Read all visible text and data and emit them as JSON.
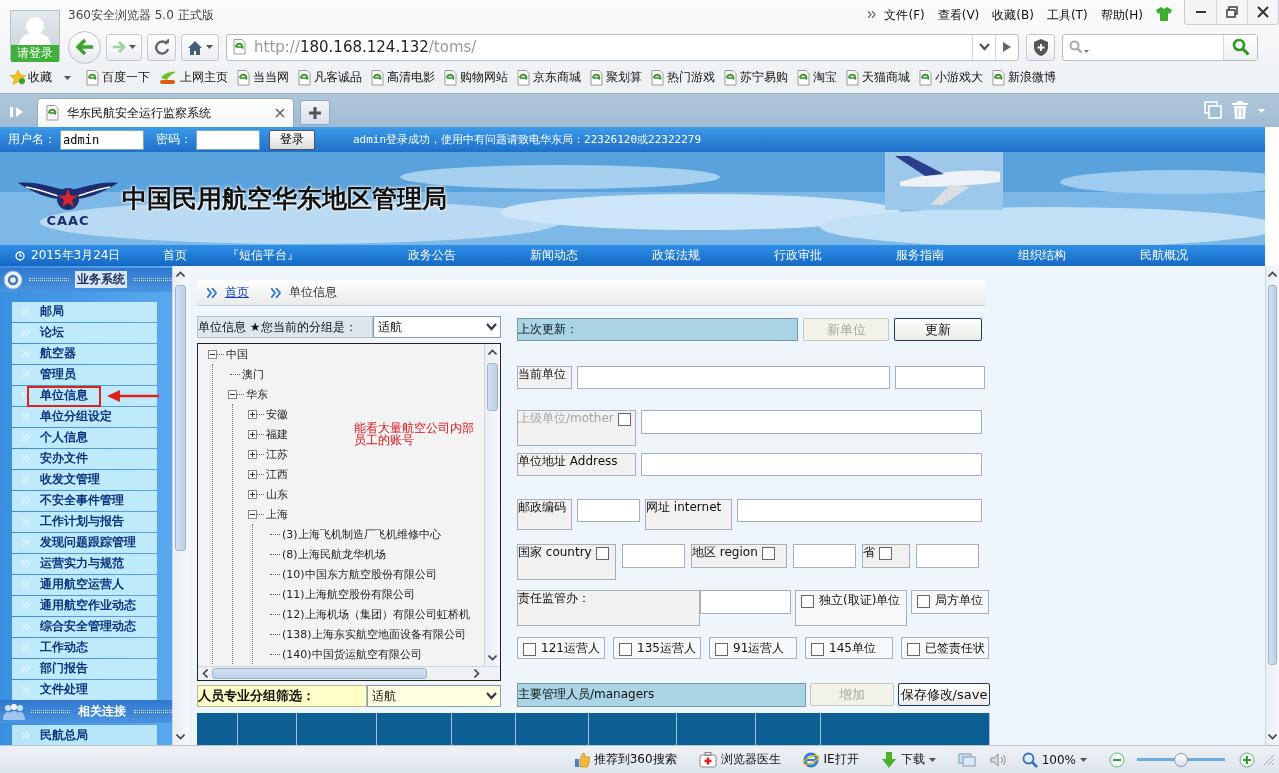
{
  "browser": {
    "title": "360安全浏览器 5.0 正式版",
    "avatar_label": "请登录",
    "menu": [
      "文件(F)",
      "查看(V)",
      "收藏(B)",
      "工具(T)",
      "帮助(H)"
    ],
    "address": {
      "scheme": "http://",
      "host": "180.168.124.132",
      "path": "/toms/"
    },
    "favorites_label": "收藏",
    "bookmarks": [
      {
        "label": "百度一下",
        "kind": "page"
      },
      {
        "label": "上网主页",
        "kind": "hao"
      },
      {
        "label": "当当网",
        "kind": "page"
      },
      {
        "label": "凡客诚品",
        "kind": "page"
      },
      {
        "label": "高清电影",
        "kind": "page"
      },
      {
        "label": "购物网站",
        "kind": "page"
      },
      {
        "label": "京东商城",
        "kind": "page"
      },
      {
        "label": "聚划算",
        "kind": "page"
      },
      {
        "label": "热门游戏",
        "kind": "page"
      },
      {
        "label": "苏宁易购",
        "kind": "page"
      },
      {
        "label": "淘宝",
        "kind": "page"
      },
      {
        "label": "天猫商城",
        "kind": "page"
      },
      {
        "label": "小游戏大",
        "kind": "page"
      },
      {
        "label": "新浪微博",
        "kind": "page"
      }
    ],
    "tabs": [
      {
        "title": "华东民航安全运行监察系统",
        "selected": true
      }
    ]
  },
  "login_bar": {
    "username_label": "用户名：",
    "username": "admin",
    "password_label": "密码：",
    "login_button": "登录",
    "message": "admin登录成功，使用中有问题请致电华东局：22326120或22322279"
  },
  "banner": {
    "title": "中国民用航空华东地区管理局",
    "logo_text": "CAAC"
  },
  "nav": {
    "date": "2015年3月24日",
    "items": [
      "首页",
      "『短信平台』",
      "政务公告",
      "新闻动态",
      "政策法规",
      "行政审批",
      "服务指南",
      "组织结构",
      "民航概况"
    ]
  },
  "sidebar": {
    "header": "业务系统",
    "items": [
      {
        "label": "邮局",
        "highlighted": false
      },
      {
        "label": "论坛",
        "highlighted": false
      },
      {
        "label": "航空器",
        "highlighted": false
      },
      {
        "label": "管理员",
        "highlighted": false
      },
      {
        "label": "单位信息",
        "highlighted": true
      },
      {
        "label": "单位分组设定",
        "highlighted": false
      },
      {
        "label": "个人信息",
        "highlighted": false
      },
      {
        "label": "安办文件",
        "highlighted": false
      },
      {
        "label": "收发文管理",
        "highlighted": false
      },
      {
        "label": "不安全事件管理",
        "highlighted": false
      },
      {
        "label": "工作计划与报告",
        "highlighted": false
      },
      {
        "label": "发现问题跟踪管理",
        "highlighted": false
      },
      {
        "label": "运营实力与规范",
        "highlighted": false
      },
      {
        "label": "通用航空运营人",
        "highlighted": false
      },
      {
        "label": "通用航空作业动态",
        "highlighted": false
      },
      {
        "label": "综合安全管理动态",
        "highlighted": false
      },
      {
        "label": "工作动态",
        "highlighted": false
      },
      {
        "label": "部门报告",
        "highlighted": false
      },
      {
        "label": "文件处理",
        "highlighted": false
      }
    ],
    "links_header": "相关连接",
    "links": [
      "民航总局"
    ]
  },
  "breadcrumb": [
    "首页",
    "单位信息"
  ],
  "unit_panel": {
    "group_label": "单位信息 ★您当前的分组是：",
    "group_value": "适航",
    "tree": [
      {
        "label": "中国",
        "expanded": true,
        "children": [
          {
            "label": "澳门"
          },
          {
            "label": "华东",
            "expanded": true,
            "children": [
              {
                "label": "安徽",
                "expanded": false
              },
              {
                "label": "福建",
                "expanded": false
              },
              {
                "label": "江苏",
                "expanded": false
              },
              {
                "label": "江西",
                "expanded": false
              },
              {
                "label": "山东",
                "expanded": false
              },
              {
                "label": "上海",
                "expanded": true,
                "children": [
                  {
                    "label": "(3)上海飞机制造厂飞机维修中心"
                  },
                  {
                    "label": "(8)上海民航龙华机场"
                  },
                  {
                    "label": "(10)中国东方航空股份有限公司"
                  },
                  {
                    "label": "(11)上海航空股份有限公司"
                  },
                  {
                    "label": "(12)上海机场（集团）有限公司虹桥机"
                  },
                  {
                    "label": "(138)上海东实航空地面设备有限公司"
                  },
                  {
                    "label": "(140)中国货运航空有限公司"
                  }
                ]
              }
            ]
          }
        ]
      }
    ],
    "annotation": "能看大量航空公司内部员工的账号",
    "filter_label": "人员专业分组筛选：",
    "filter_value": "适航"
  },
  "form": {
    "lines": [
      {
        "fields": [
          {
            "kind": "header",
            "text": "上次更新："
          },
          {
            "kind": "button",
            "text": "新单位",
            "disabled": true
          },
          {
            "kind": "button",
            "text": "更新",
            "disabled": false
          }
        ]
      },
      {
        "fields": [
          {
            "kind": "label",
            "text": "当前单位"
          },
          {
            "kind": "input"
          },
          {
            "kind": "input"
          }
        ]
      },
      {
        "fields": [
          {
            "kind": "label",
            "text": "上级单位/mother",
            "disabled": true,
            "checked": false
          },
          {
            "kind": "input"
          }
        ]
      },
      {
        "fields": [
          {
            "kind": "label",
            "text": "单位地址 Address"
          },
          {
            "kind": "input"
          }
        ]
      },
      {
        "fields": [
          {
            "kind": "label",
            "text": "邮政编码"
          },
          {
            "kind": "input"
          },
          {
            "kind": "label",
            "text": "网址 internet"
          },
          {
            "kind": "input"
          }
        ]
      },
      {
        "fields": [
          {
            "kind": "label",
            "text": "国家 country",
            "checked": false
          },
          {
            "kind": "input"
          },
          {
            "kind": "label",
            "text": "地区 region",
            "checked": false
          },
          {
            "kind": "input"
          },
          {
            "kind": "label",
            "text": "省",
            "checked": false
          },
          {
            "kind": "input"
          }
        ]
      },
      {
        "fields": [
          {
            "kind": "label",
            "text": "责任监管办："
          },
          {
            "kind": "input"
          },
          {
            "kind": "check",
            "text": "独立(取证)单位",
            "checked": false
          },
          {
            "kind": "check",
            "text": "局方单位",
            "checked": false
          }
        ]
      },
      {
        "fields": [
          {
            "kind": "check",
            "text": "121运营人",
            "checked": false
          },
          {
            "kind": "check",
            "text": "135运营人",
            "checked": false
          },
          {
            "kind": "check",
            "text": "91运营人",
            "checked": false
          },
          {
            "kind": "check",
            "text": "145单位",
            "checked": false
          },
          {
            "kind": "check",
            "text": "已签责任状",
            "checked": false
          }
        ]
      },
      {
        "fields": [
          {
            "kind": "header",
            "text": "主要管理人员/managers"
          },
          {
            "kind": "button",
            "text": "增加",
            "disabled": true
          },
          {
            "kind": "button",
            "text": "保存修改/save",
            "disabled": false
          }
        ]
      }
    ]
  },
  "status_bar": {
    "items": [
      {
        "label": "推荐到360搜索",
        "kind": "thumb"
      },
      {
        "label": "浏览器医生",
        "kind": "kit"
      },
      {
        "label": "IE打开",
        "kind": "ie"
      },
      {
        "label": "下载",
        "kind": "download"
      }
    ],
    "zoom": "100%",
    "zoom_slider": {
      "level": 0.5
    }
  }
}
